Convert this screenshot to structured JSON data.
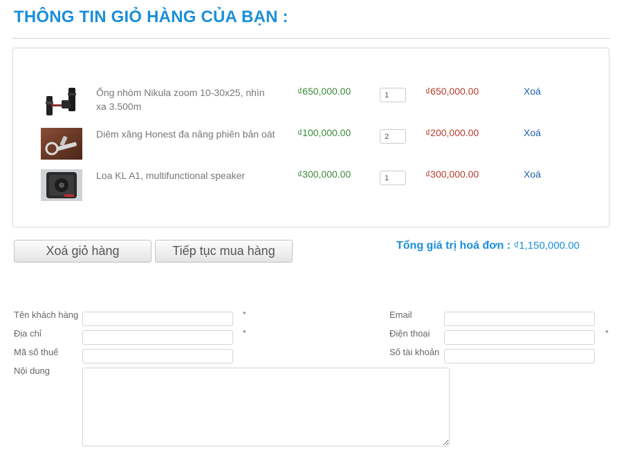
{
  "page": {
    "title": "THÔNG TIN GIỎ HÀNG CỦA BẠN :"
  },
  "cart": {
    "items": [
      {
        "name": "Ống nhòm Nikula zoom 10-30x25, nhìn xa 3.500m",
        "unit_price": "₫650,000.00",
        "quantity": "1",
        "line_total": "₫650,000.00",
        "remove_label": "Xoá",
        "thumbnail_icon": "binocular-icon"
      },
      {
        "name": "Diêm xăng Honest đa năng phiên bản oát",
        "unit_price": "₫100,000.00",
        "quantity": "2",
        "line_total": "₫200,000.00",
        "remove_label": "Xoá",
        "thumbnail_icon": "lighter-icon"
      },
      {
        "name": "Loa KL A1, multifunctional speaker",
        "unit_price": "₫300,000.00",
        "quantity": "1",
        "line_total": "₫300,000.00",
        "remove_label": "Xoá",
        "thumbnail_icon": "speaker-icon"
      }
    ]
  },
  "actions": {
    "clear_cart_label": "Xoá giỏ hàng",
    "continue_shopping_label": "Tiếp tục mua hàng"
  },
  "summary": {
    "total_label": "Tổng giá trị hoá đơn :",
    "total_value": "₫1,150,000.00"
  },
  "form": {
    "customer_name_label": "Tên khách hàng",
    "email_label": "Email",
    "address_label": "Địa chỉ",
    "phone_label": "Điện thoại",
    "tax_code_label": "Mã số thuế",
    "account_label": "Số tài khoản",
    "content_label": "Nội dung",
    "required_marker": "*"
  },
  "colors": {
    "accent": "#1a8fd9",
    "price": "#3a8a3a",
    "line_total": "#b53b2b",
    "link": "#1d5fa8"
  }
}
